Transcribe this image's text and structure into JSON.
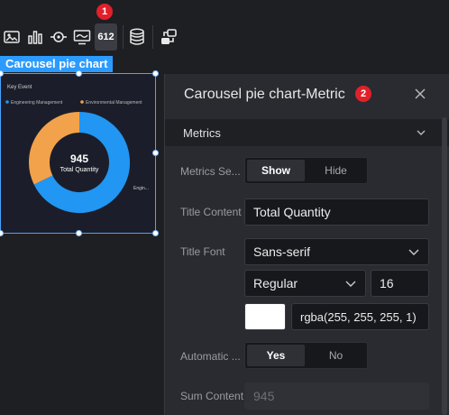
{
  "toolbar": {
    "icons": [
      "image-icon",
      "bar-chart-icon",
      "eye-target-icon",
      "monitor-icon",
      "number-flop-icon",
      "database-icon",
      "linkage-icon"
    ],
    "number_label": "612",
    "marker": "1"
  },
  "chart_tag": "Carousel pie chart",
  "chart_data": {
    "type": "pie",
    "title": "Key Event",
    "legend": [
      "Engineering Management",
      "Environmental Management"
    ],
    "center_value": "945",
    "center_label": "Total Quantity",
    "slice_label": "Engin...",
    "colors": [
      "#2196f3",
      "#f2a24a"
    ]
  },
  "panel": {
    "title": "Carousel pie chart-Metric",
    "marker": "2",
    "section": "Metrics",
    "metrics_setting": {
      "label": "Metrics Se...",
      "on": "Show",
      "off": "Hide"
    },
    "title_content": {
      "label": "Title Content",
      "value": "Total Quantity"
    },
    "title_font": {
      "label": "Title Font",
      "family": "Sans-serif",
      "weight": "Regular",
      "size": "16",
      "color": "rgba(255, 255, 255, 1)"
    },
    "automatic": {
      "label": "Automatic ...",
      "on": "Yes",
      "off": "No"
    },
    "sum_content": {
      "label": "Sum Content",
      "value": "945"
    }
  }
}
